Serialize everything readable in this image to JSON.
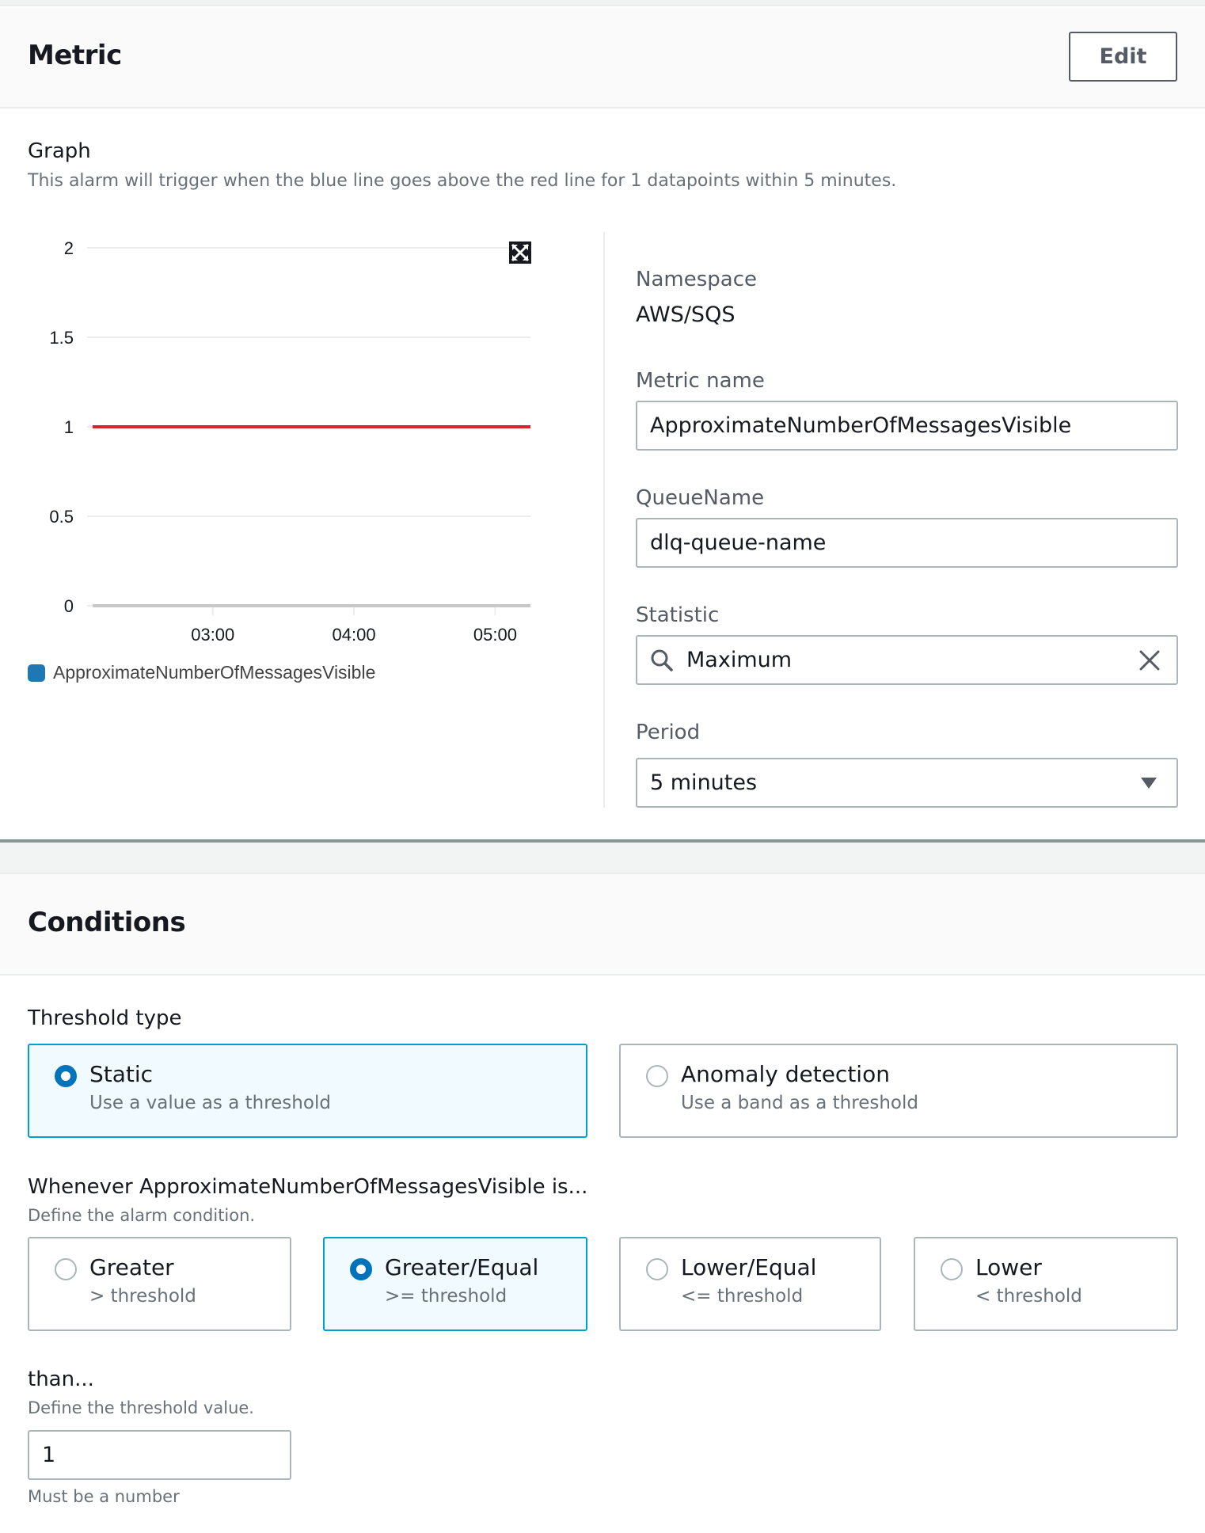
{
  "metric_section": {
    "title": "Metric",
    "edit_label": "Edit",
    "graph": {
      "label": "Graph",
      "description": "This alarm will trigger when the blue line goes above the red line for 1 datapoints within 5 minutes.",
      "expand_icon": "expand-arrows-icon"
    },
    "fields": {
      "namespace_label": "Namespace",
      "namespace_value": "AWS/SQS",
      "metric_name_label": "Metric name",
      "metric_name_value": "ApproximateNumberOfMessagesVisible",
      "queue_name_label": "QueueName",
      "queue_name_value": "dlq-queue-name",
      "statistic_label": "Statistic",
      "statistic_value": "Maximum",
      "statistic_search_icon": "search-icon",
      "statistic_clear_icon": "close-icon",
      "period_label": "Period",
      "period_value": "5 minutes",
      "period_dropdown_icon": "caret-down-icon"
    }
  },
  "chart_data": {
    "type": "line",
    "title": "",
    "xlabel": "",
    "ylabel": "",
    "ylim": [
      0,
      2
    ],
    "y_ticks": [
      "0",
      "0.5",
      "1",
      "1.5",
      "2"
    ],
    "y_tick_values": [
      0,
      0.5,
      1,
      1.5,
      2
    ],
    "x_ticks": [
      "03:00",
      "04:00",
      "05:00"
    ],
    "x_range_hours": [
      2.25,
      5.25
    ],
    "x_tick_hours": [
      3,
      4,
      5
    ],
    "grid": true,
    "legend_position": "bottom-left",
    "series": [
      {
        "name": "ApproximateNumberOfMessagesVisible",
        "color": "#1f77b4",
        "x_hours": [
          2.25,
          5.25
        ],
        "values": [
          0,
          0
        ]
      }
    ],
    "threshold": {
      "value": 1,
      "color": "#d62728"
    }
  },
  "conditions_section": {
    "title": "Conditions",
    "threshold_type": {
      "label": "Threshold type",
      "options": [
        {
          "title": "Static",
          "subtitle": "Use a value as a threshold",
          "selected": true
        },
        {
          "title": "Anomaly detection",
          "subtitle": "Use a band as a threshold",
          "selected": false
        }
      ]
    },
    "whenever": {
      "label": "Whenever ApproximateNumberOfMessagesVisible is...",
      "description": "Define the alarm condition.",
      "options": [
        {
          "title": "Greater",
          "subtitle": "> threshold",
          "selected": false
        },
        {
          "title": "Greater/Equal",
          "subtitle": ">= threshold",
          "selected": true
        },
        {
          "title": "Lower/Equal",
          "subtitle": "<= threshold",
          "selected": false
        },
        {
          "title": "Lower",
          "subtitle": "< threshold",
          "selected": false
        }
      ]
    },
    "than": {
      "label": "than...",
      "description": "Define the threshold value.",
      "value": "1",
      "hint": "Must be a number"
    }
  },
  "colors": {
    "accent": "#0073bb",
    "selected_border": "#00a1c9",
    "selected_bg": "#f1faff",
    "threshold_line": "#d62728",
    "series_line": "#1f77b4"
  }
}
